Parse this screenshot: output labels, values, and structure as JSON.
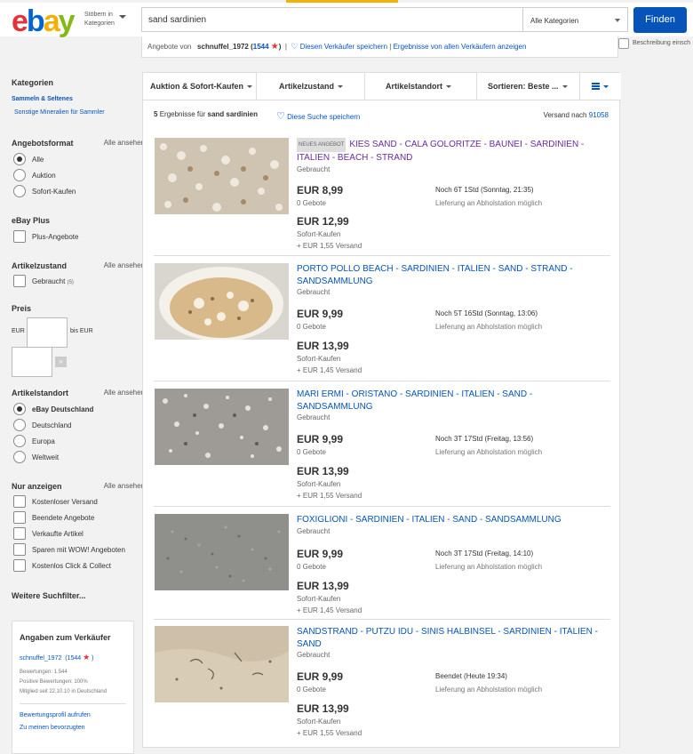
{
  "header": {
    "logo": {
      "e": "e",
      "b": "b",
      "a": "a",
      "y": "y"
    },
    "browse_label": "Stöbern in Kategorien",
    "search_value": "sand sardinien",
    "category_select": "Alle Kategorien",
    "find_button": "Finden"
  },
  "seller_bar": {
    "prefix": "Angebote von",
    "seller": "schnuffel_1972",
    "score_open": "(",
    "score": "1544",
    "score_close": ")",
    "divider": "|",
    "save_seller": "Diesen Verkäufer speichern",
    "all_items": "Ergebnisse von allen Verkäufern anzeigen",
    "desc_label": "Beschreibung einsch"
  },
  "sidebar": {
    "categories_heading": "Kategorien",
    "category": "Sammeln & Seltenes",
    "subcategory": "Sonstige Mineralien für Sammler",
    "format": {
      "heading": "Angebotsformat",
      "all": "Alle ansehen",
      "options": [
        "Alle",
        "Auktion",
        "Sofort-Kaufen"
      ],
      "selected": 0
    },
    "ebay_plus": {
      "heading": "eBay Plus",
      "option": "Plus-Angebote"
    },
    "condition": {
      "heading": "Artikelzustand",
      "all": "Alle ansehen",
      "option": "Gebraucht",
      "count": "(5)"
    },
    "price": {
      "heading": "Preis",
      "from_label": "EUR",
      "to_label": "bis EUR",
      "go": "»"
    },
    "location": {
      "heading": "Artikelstandort",
      "all": "Alle ansehen",
      "options": [
        "eBay Deutschland",
        "Deutschland",
        "Europa",
        "Weltweit"
      ],
      "selected": 0
    },
    "only_show": {
      "heading": "Nur anzeigen",
      "all": "Alle ansehen",
      "options": [
        "Kostenloser Versand",
        "Beendete Angebote",
        "Verkaufte Artikel",
        "Sparen mit WOW! Angeboten",
        "Kostenlos Click & Collect"
      ]
    },
    "more_filters": "Weitere Suchfilter...",
    "seller_info": {
      "heading": "Angaben zum Verkäufer",
      "name": "schnuffel_1972",
      "score": "(1544",
      "score_close": ")",
      "ratings": "Bewertungen: 1.544",
      "positive": "Positive Bewertungen: 100%",
      "member": "Mitglied seit 22.10.10 in Deutschland",
      "profile_link": "Bewertungsprofil aufrufen",
      "favorite_link": "Zu meinen bevorzugten"
    }
  },
  "tabs": [
    "Auktion & Sofort-Kaufen",
    "Artikelzustand",
    "Artikelstandort",
    "Sortieren: Beste ..."
  ],
  "results": {
    "count": "5",
    "text_mid": "Ergebnisse für",
    "query": "sand sardinien",
    "save_search": "Diese Suche speichern",
    "ship_to_label": "Versand nach",
    "ship_to_zip": "91058"
  },
  "items": [
    {
      "badge": "NEUES ANGEBOT",
      "title": "KIES SAND - CALA GOLORITZE - BAUNEI - SARDINIEN - ITALIEN - BEACH - STRAND",
      "condition": "Gebraucht",
      "bid_price": "EUR 8,99",
      "bids": "0 Gebote",
      "bin_price": "EUR 12,99",
      "bin_label": "Sofort-Kaufen",
      "shipping": "+ EUR 1,55 Versand",
      "time_left": "Noch 6T 1Std (Sonntag, 21:35)",
      "pickup": "Lieferung an Abholstation möglich"
    },
    {
      "badge": "",
      "title": "PORTO POLLO BEACH - SARDINIEN - ITALIEN - SAND - STRAND - SANDSAMMLUNG",
      "condition": "Gebraucht",
      "bid_price": "EUR 9,99",
      "bids": "0 Gebote",
      "bin_price": "EUR 13,99",
      "bin_label": "Sofort-Kaufen",
      "shipping": "+ EUR 1,45 Versand",
      "time_left": "Noch 5T 16Std (Sonntag, 13:06)",
      "pickup": "Lieferung an Abholstation möglich"
    },
    {
      "badge": "",
      "title": "MARI ERMI - ORISTANO - SARDINIEN - ITALIEN - SAND - SANDSAMMLUNG",
      "condition": "Gebraucht",
      "bid_price": "EUR 9,99",
      "bids": "0 Gebote",
      "bin_price": "EUR 13,99",
      "bin_label": "Sofort-Kaufen",
      "shipping": "+ EUR 1,55 Versand",
      "time_left": "Noch 3T 17Std (Freitag, 13:56)",
      "pickup": "Lieferung an Abholstation möglich"
    },
    {
      "badge": "",
      "title": "FOXIGLIONI - SARDINIEN - ITALIEN - SAND - SANDSAMMLUNG",
      "condition": "Gebraucht",
      "bid_price": "EUR 9,99",
      "bids": "0 Gebote",
      "bin_price": "EUR 13,99",
      "bin_label": "Sofort-Kaufen",
      "shipping": "+ EUR 1,45 Versand",
      "time_left": "Noch 3T 17Std (Freitag, 14:10)",
      "pickup": "Lieferung an Abholstation möglich"
    },
    {
      "badge": "",
      "title": "SANDSTRAND - PUTZU IDU - SINIS HALBINSEL - SARDINIEN - ITALIEN - SAND",
      "condition": "Gebraucht",
      "bid_price": "EUR 9,99",
      "bids": "0 Gebote",
      "bin_price": "EUR 13,99",
      "bin_label": "Sofort-Kaufen",
      "shipping": "+ EUR 1,55 Versand",
      "time_left": "Beendet (Heute 19:34)",
      "pickup": "Lieferung an Abholstation möglich"
    }
  ],
  "colors": {
    "link": "#0654ba",
    "visited": "#6b2aa1",
    "button": "#0654ba",
    "star": "#e53238"
  }
}
